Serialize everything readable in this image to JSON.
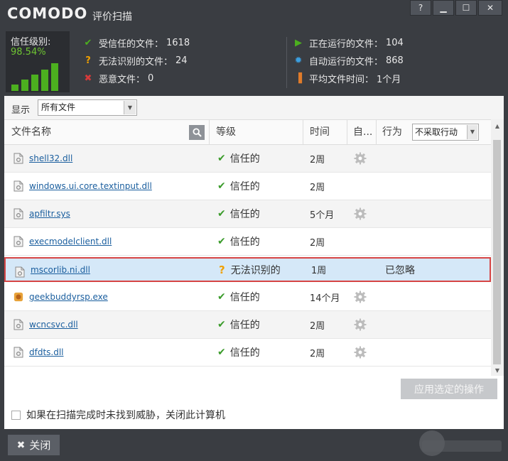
{
  "window": {
    "logo": "COMODO",
    "title": "评价扫描",
    "buttons": {
      "help": "?",
      "minimize": "▁",
      "maximize": "☐",
      "close": "✕"
    }
  },
  "trust": {
    "label": "信任级别:",
    "value": "98.54%",
    "bar_levels": [
      0.2,
      0.35,
      0.5,
      0.65,
      0.85
    ]
  },
  "stats_left": [
    {
      "icon": "check-icon",
      "color": "#4caf1f",
      "label": "受信任的文件：",
      "value": "1618"
    },
    {
      "icon": "question-icon",
      "color": "#f0a000",
      "label": "无法识别的文件：",
      "value": "24"
    },
    {
      "icon": "x-icon",
      "color": "#d63a3a",
      "label": "恶意文件：",
      "value": "0"
    }
  ],
  "stats_right": [
    {
      "icon": "play-icon",
      "color": "#4caf1f",
      "label": "正在运行的文件：",
      "value": "104"
    },
    {
      "icon": "gear-icon",
      "color": "#3b9fe0",
      "label": "自动运行的文件：",
      "value": "868"
    },
    {
      "icon": "bar-chart-icon",
      "color": "#e07b2a",
      "label": "平均文件时间：",
      "value": "1个月"
    }
  ],
  "filter": {
    "label": "显示",
    "selected": "所有文件"
  },
  "columns": {
    "name": "文件名称",
    "rating": "等级",
    "time": "时间",
    "auto": "自...",
    "action": "行为",
    "action_select": "不采取行动"
  },
  "rows": [
    {
      "name": "shell32.dll",
      "status": "信任的",
      "type": "trusted",
      "time": "2周",
      "auto": true,
      "action": "",
      "icon": "dll-file-icon"
    },
    {
      "name": "windows.ui.core.textinput.dll",
      "status": "信任的",
      "type": "trusted",
      "time": "2周",
      "auto": false,
      "action": "",
      "icon": "dll-file-icon"
    },
    {
      "name": "apfiltr.sys",
      "status": "信任的",
      "type": "trusted",
      "time": "5个月",
      "auto": true,
      "action": "",
      "icon": "sys-file-icon"
    },
    {
      "name": "execmodelclient.dll",
      "status": "信任的",
      "type": "trusted",
      "time": "2周",
      "auto": false,
      "action": "",
      "icon": "dll-file-icon"
    },
    {
      "name": "mscorlib.ni.dll",
      "status": "无法识别的",
      "type": "unknown",
      "time": "1周",
      "auto": false,
      "action": "已忽略",
      "icon": "dll-file-icon",
      "selected": true
    },
    {
      "name": "geekbuddyrsp.exe",
      "status": "信任的",
      "type": "trusted",
      "time": "14个月",
      "auto": true,
      "action": "",
      "icon": "exe-app-icon"
    },
    {
      "name": "wcncsvc.dll",
      "status": "信任的",
      "type": "trusted",
      "time": "2周",
      "auto": true,
      "action": "",
      "icon": "dll-file-icon"
    },
    {
      "name": "dfdts.dll",
      "status": "信任的",
      "type": "trusted",
      "time": "2周",
      "auto": true,
      "action": "",
      "icon": "dll-file-icon"
    }
  ],
  "footer": {
    "apply": "应用选定的操作",
    "shutdown": "如果在扫描完成时未找到威胁，关闭此计算机",
    "close": "关闭"
  }
}
